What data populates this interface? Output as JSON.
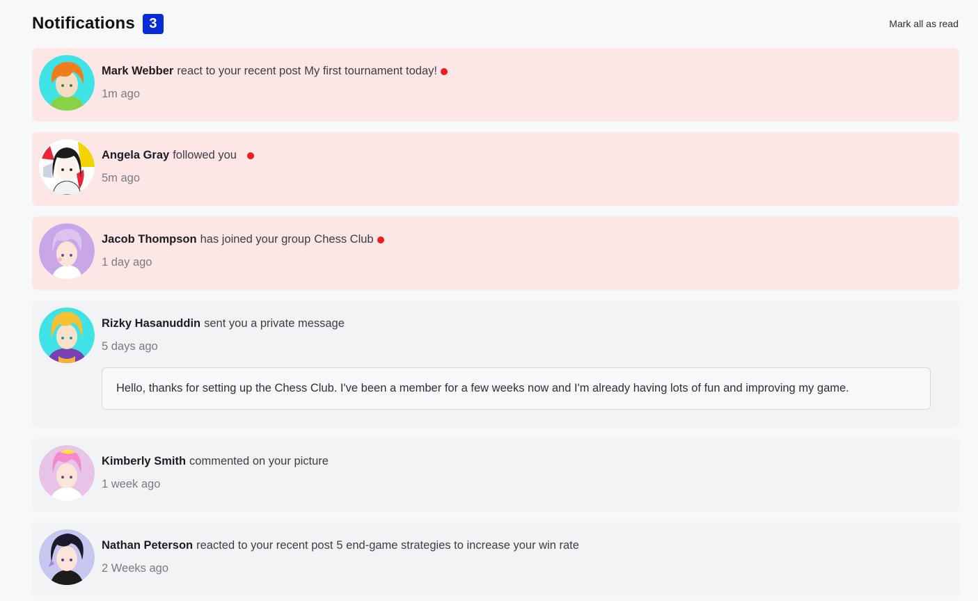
{
  "header": {
    "title": "Notifications",
    "unread_count": "3",
    "mark_all_label": "Mark all as read"
  },
  "notifications": [
    {
      "name": "Mark Webber",
      "action": "react to your recent post",
      "target": "My first tournament today!",
      "time": "1m ago",
      "unread": true,
      "avatar": "avatar-orange-hair"
    },
    {
      "name": "Angela Gray",
      "action": "followed you",
      "target": "",
      "time": "5m ago",
      "unread": true,
      "avatar": "avatar-dark-hair-girl"
    },
    {
      "name": "Jacob Thompson",
      "action": "has joined your group",
      "target": "Chess Club",
      "time": "1 day ago",
      "unread": true,
      "avatar": "avatar-lavender-hair"
    },
    {
      "name": "Rizky Hasanuddin",
      "action": "sent you a private message",
      "target": "",
      "time": "5 days ago",
      "unread": false,
      "avatar": "avatar-blonde-boy",
      "message": "Hello, thanks for setting up the Chess Club. I've been a member for a few weeks now and I'm already having lots of fun and improving my game."
    },
    {
      "name": "Kimberly Smith",
      "action": "commented on your picture",
      "target": "",
      "time": "1 week ago",
      "unread": false,
      "avatar": "avatar-pink-hair"
    },
    {
      "name": "Nathan Peterson",
      "action": "reacted to your recent post",
      "target": "5 end-game strategies to increase your win rate",
      "time": "2 Weeks ago",
      "unread": false,
      "avatar": "avatar-black-hair-boy"
    }
  ]
}
